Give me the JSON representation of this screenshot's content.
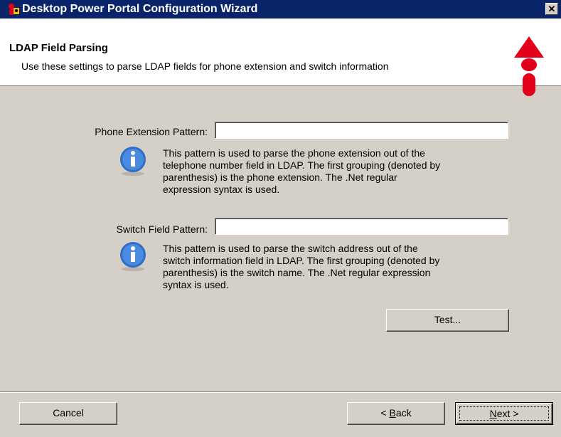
{
  "window": {
    "title": "Desktop Power Portal Configuration Wizard",
    "close_label": "✕"
  },
  "header": {
    "title": "LDAP Field Parsing",
    "subtitle": "Use these settings to parse LDAP fields for phone extension and switch information"
  },
  "phone": {
    "label": "Phone Extension Pattern:",
    "value": "",
    "info": [
      "This pattern is used to parse the phone extension out of the",
      "telephone number field in LDAP.  The first grouping (denoted by",
      "parenthesis) is the phone extension.  The .Net regular",
      "expression syntax is used."
    ]
  },
  "switch": {
    "label": "Switch Field Pattern:",
    "value": "",
    "info": [
      "This pattern is used to parse the switch address out of the",
      "switch information field in LDAP.  The first grouping (denoted by",
      "parenthesis) is the switch name.  The .Net regular expression",
      "syntax is used."
    ]
  },
  "buttons": {
    "test": "Test...",
    "cancel": "Cancel",
    "back_accel": "B",
    "back_pre": "< ",
    "back_rest": "ack",
    "next_accel": "N",
    "next_rest": "ext >"
  },
  "colors": {
    "titlebar": "#0a246a",
    "face": "#d4d0c8",
    "logo_red": "#e3001b"
  }
}
